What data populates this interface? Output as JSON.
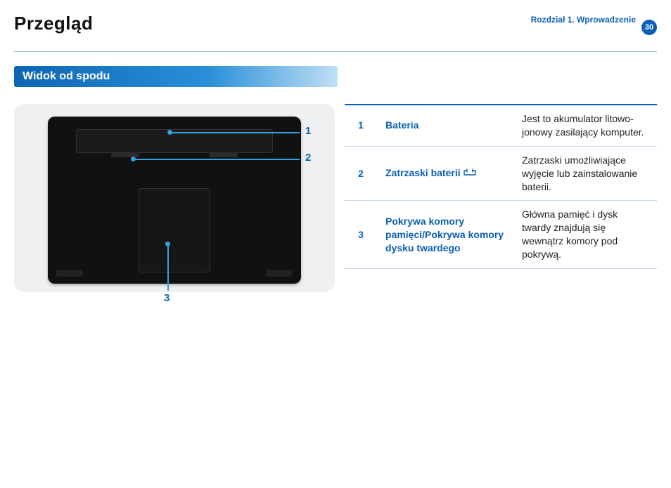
{
  "header": {
    "title": "Przegląd",
    "chapter_line1": "Rozdział 1.",
    "chapter_line2": "Wprowadzenie",
    "page_number": "30"
  },
  "section": {
    "title": "Widok od spodu"
  },
  "figure": {
    "callouts": {
      "c1": "1",
      "c2": "2",
      "c3": "3"
    }
  },
  "parts": [
    {
      "num": "1",
      "name": "Bateria",
      "has_icon": false,
      "desc": "Jest to akumulator litowo-jonowy zasilający komputer."
    },
    {
      "num": "2",
      "name": "Zatrzaski baterii",
      "has_icon": true,
      "desc": "Zatrzaski umożliwiające wyjęcie lub zainstalowanie baterii."
    },
    {
      "num": "3",
      "name": "Pokrywa komory pamięci/Pokrywa komory dysku twardego",
      "has_icon": false,
      "desc": "Główna pamięć i dysk twardy znajdują się wewnątrz komory pod pokrywą."
    }
  ],
  "colors": {
    "accent": "#0a5fb4"
  }
}
